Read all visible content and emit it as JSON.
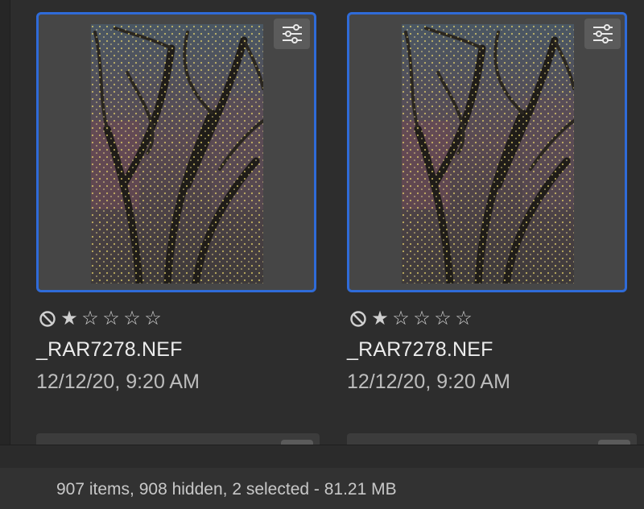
{
  "grid": {
    "items": [
      {
        "filename": "_RAR7278.NEF",
        "datetime": "12/12/20, 9:20 AM",
        "rating": 1,
        "max_rating": 5,
        "selected": true,
        "adjust_icon": "sliders-icon",
        "reject_icon": "reject-flag-icon"
      },
      {
        "filename": "_RAR7278.NEF",
        "datetime": "12/12/20, 9:20 AM",
        "rating": 1,
        "max_rating": 5,
        "selected": true,
        "adjust_icon": "sliders-icon",
        "reject_icon": "reject-flag-icon"
      }
    ]
  },
  "status_bar": {
    "text": "907 items, 908 hidden, 2 selected - 81.21 MB"
  },
  "colors": {
    "selection_border": "#2f6bd8",
    "background": "#2d2d2d"
  }
}
